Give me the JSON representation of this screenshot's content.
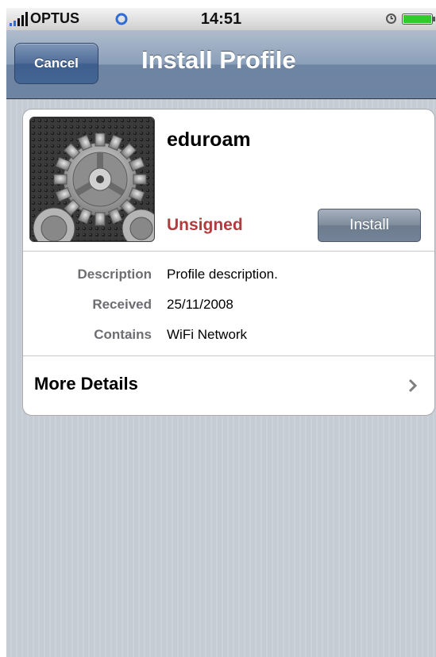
{
  "status_bar": {
    "carrier": "OPTUS",
    "time": "14:51",
    "icons": [
      "signal-bars-icon",
      "wifi-icon",
      "alarm-icon",
      "battery-icon"
    ]
  },
  "nav": {
    "cancel_label": "Cancel",
    "title": "Install Profile"
  },
  "profile": {
    "name": "eduroam",
    "icon": "settings-gears-icon",
    "status": "Unsigned",
    "install_label": "Install",
    "details": [
      {
        "label": "Description",
        "value": "Profile description."
      },
      {
        "label": "Received",
        "value": "25/11/2008"
      },
      {
        "label": "Contains",
        "value": "WiFi Network"
      }
    ],
    "more_details_label": "More Details"
  },
  "colors": {
    "nav_bar": "#6d84a2",
    "unsigned_text": "#b23b3e",
    "background": "#c5ccd4",
    "battery_fill": "#2fcc2a"
  }
}
